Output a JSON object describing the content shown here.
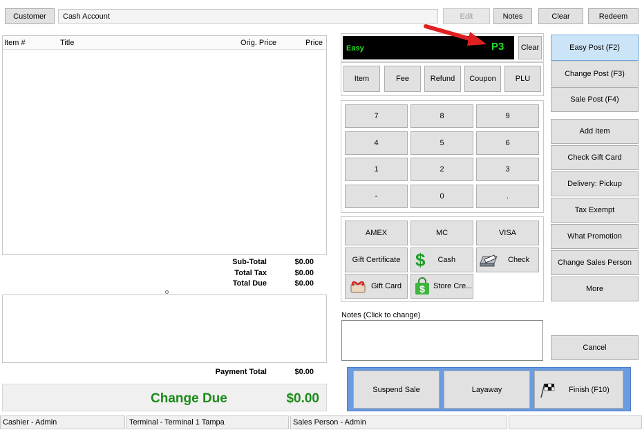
{
  "top": {
    "customer_label": "Customer",
    "account_value": "Cash Account",
    "edit_label": "Edit",
    "notes_label": "Notes",
    "clear_label": "Clear",
    "redeem_label": "Redeem"
  },
  "items_table": {
    "columns": [
      "Item #",
      "Title",
      "Orig. Price",
      "Price"
    ]
  },
  "totals": {
    "subtotal_label": "Sub-Total",
    "subtotal_value": "$0.00",
    "tax_label": "Total Tax",
    "tax_value": "$0.00",
    "due_label": "Total Due",
    "due_value": "$0.00",
    "payment_total_label": "Payment Total",
    "payment_total_value": "$0.00",
    "change_due_label": "Change Due",
    "change_due_value": "$0.00"
  },
  "display": {
    "mode": "Easy",
    "code": "P3",
    "clear_label": "Clear",
    "mode_color": "#22dd22",
    "code_color": "#22dd22"
  },
  "item_types": [
    "Item",
    "Fee",
    "Refund",
    "Coupon",
    "PLU"
  ],
  "keypad": [
    "7",
    "8",
    "9",
    "4",
    "5",
    "6",
    "1",
    "2",
    "3",
    "-",
    "0",
    "."
  ],
  "tenders": {
    "amex": "AMEX",
    "mc": "MC",
    "visa": "VISA",
    "gift_certificate": "Gift Certificate",
    "cash": "Cash",
    "check": "Check",
    "gift_card": "Gift Card",
    "store_credit": "Store Cre..."
  },
  "notes": {
    "label": "Notes (Click to change)"
  },
  "actions": {
    "suspend": "Suspend Sale",
    "layaway": "Layaway",
    "finish": "Finish (F10)"
  },
  "side": {
    "easy_post": "Easy Post (F2)",
    "change_post": "Change Post (F3)",
    "sale_post": "Sale Post (F4)",
    "add_item": "Add Item",
    "check_gift_card": "Check Gift Card",
    "delivery": "Delivery: Pickup",
    "tax_exempt": "Tax Exempt",
    "what_promotion": "What Promotion",
    "change_sales_person": "Change Sales Person",
    "more": "More",
    "cancel": "Cancel"
  },
  "status": {
    "cashier": "Cashier - Admin",
    "terminal": "Terminal - Terminal 1 Tampa",
    "sales_person": "Sales Person - Admin"
  },
  "colors": {
    "change_due": "#1a8a1a",
    "accent_frame": "#6b9be0",
    "arrow": "#e02020"
  }
}
